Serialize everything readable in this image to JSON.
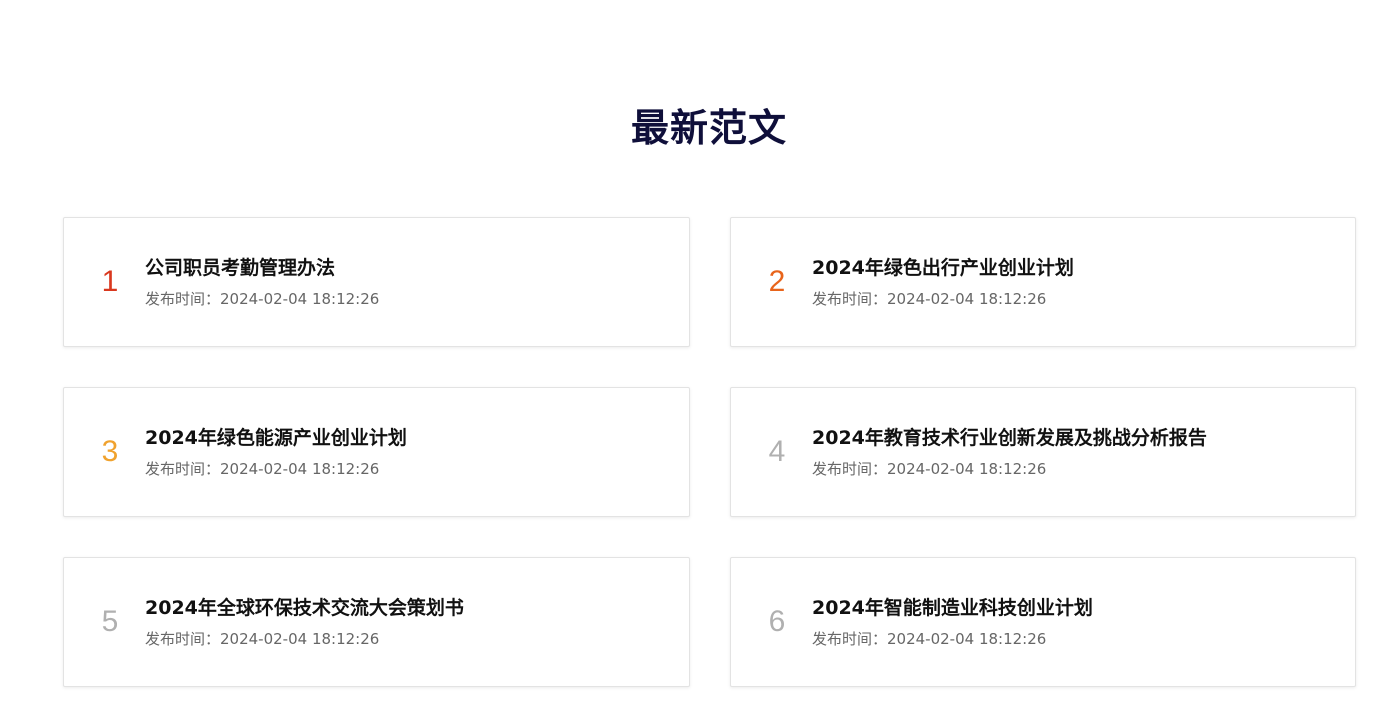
{
  "section": {
    "title": "最新范文"
  },
  "colors": {
    "rank_1": "#d9381e",
    "rank_2": "#e8641b",
    "rank_3": "#f0a22e",
    "rank_other": "#b0b0b0"
  },
  "articles": [
    {
      "rank": "1",
      "title": "公司职员考勤管理办法",
      "meta": "发布时间：2024-02-04 18:12:26"
    },
    {
      "rank": "2",
      "title": "2024年绿色出行产业创业计划",
      "meta": "发布时间：2024-02-04 18:12:26"
    },
    {
      "rank": "3",
      "title": "2024年绿色能源产业创业计划",
      "meta": "发布时间：2024-02-04 18:12:26"
    },
    {
      "rank": "4",
      "title": "2024年教育技术行业创新发展及挑战分析报告",
      "meta": "发布时间：2024-02-04 18:12:26"
    },
    {
      "rank": "5",
      "title": "2024年全球环保技术交流大会策划书",
      "meta": "发布时间：2024-02-04 18:12:26"
    },
    {
      "rank": "6",
      "title": "2024年智能制造业科技创业计划",
      "meta": "发布时间：2024-02-04 18:12:26"
    }
  ]
}
